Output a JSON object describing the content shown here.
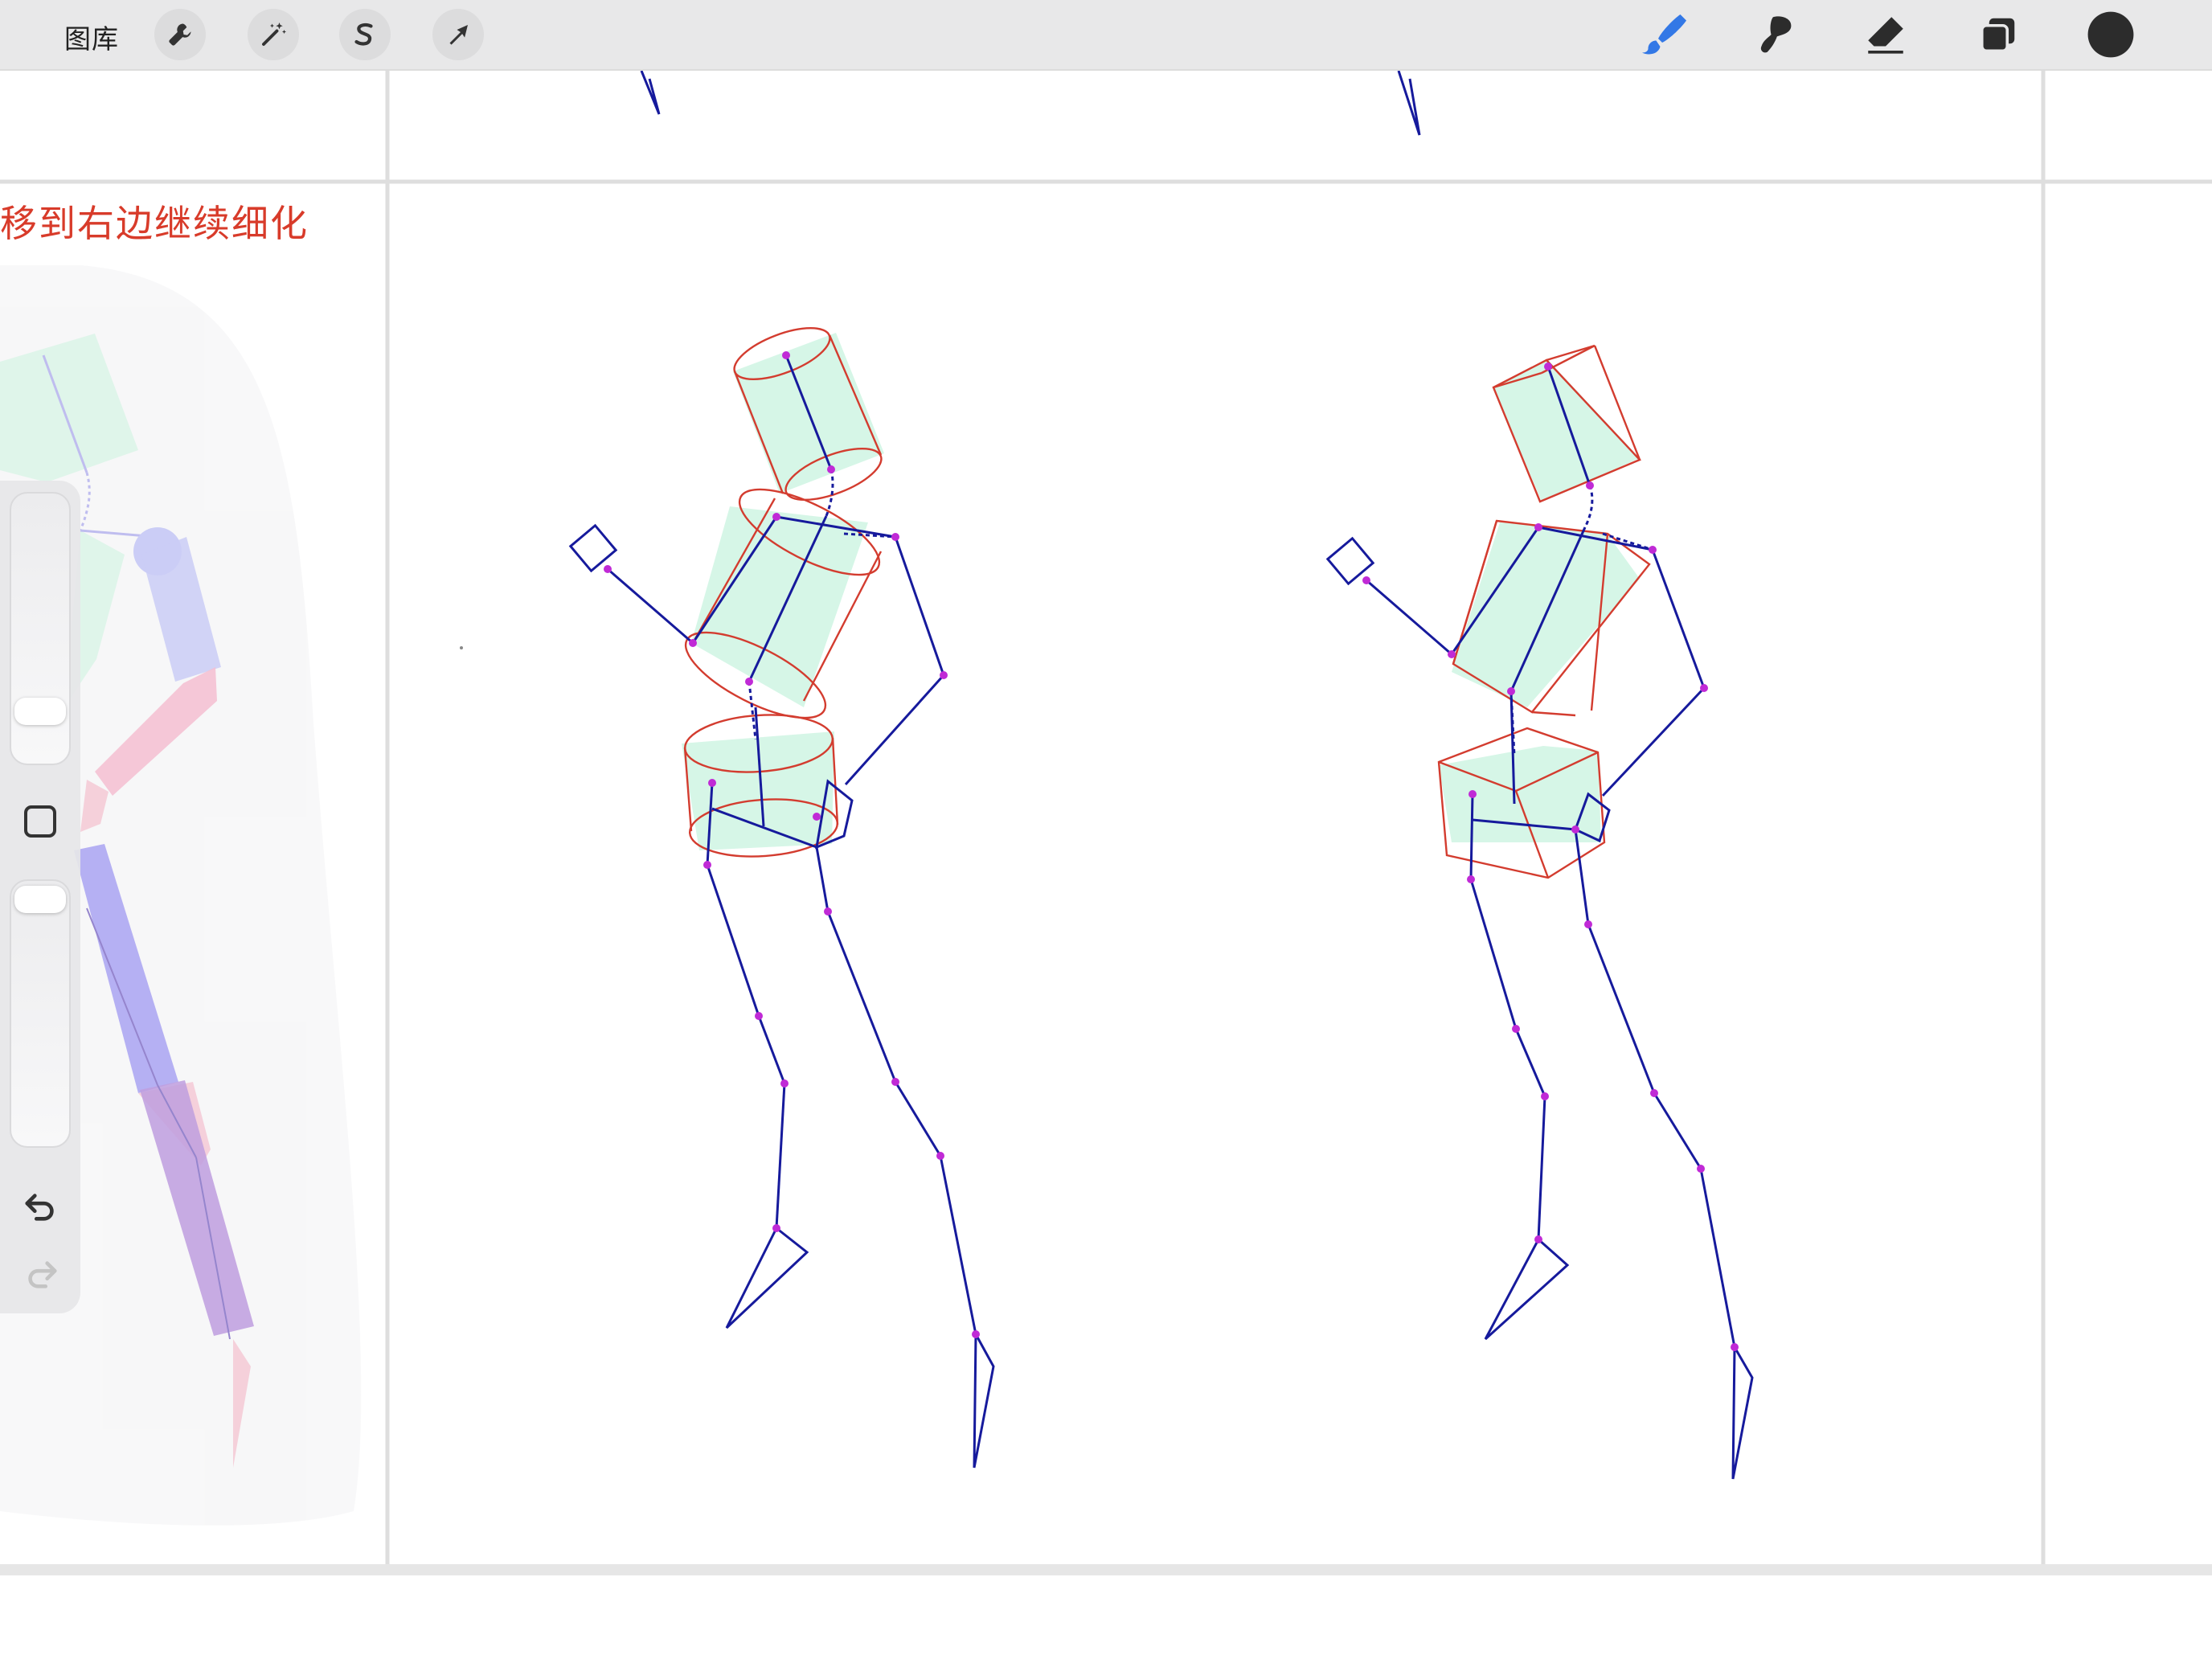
{
  "toolbar": {
    "gallery_label": "图库",
    "left_tools": [
      "wrench-icon",
      "magic-wand-icon",
      "selection-s-icon",
      "transform-arrow-icon"
    ],
    "right_tools": [
      "brush-icon",
      "smudge-icon",
      "eraser-icon",
      "layers-icon",
      "color-swatch-icon"
    ],
    "active_tool": "brush-icon",
    "active_color": "#3378e6",
    "current_color": "#2c2c2c"
  },
  "canvas": {
    "annotation": "移到右边继续细化",
    "annotation_color": "#d83b2a",
    "stroke_color": "#161a9c",
    "guide_color": "#d33c2f",
    "joint_color": "#c02ad6",
    "fill_color": "#d6f6e7"
  },
  "sidebar": {
    "brush_size_level": 0.35,
    "opacity_level": 0.05,
    "buttons": [
      "modify-button-icon",
      "undo-icon",
      "redo-icon"
    ]
  }
}
